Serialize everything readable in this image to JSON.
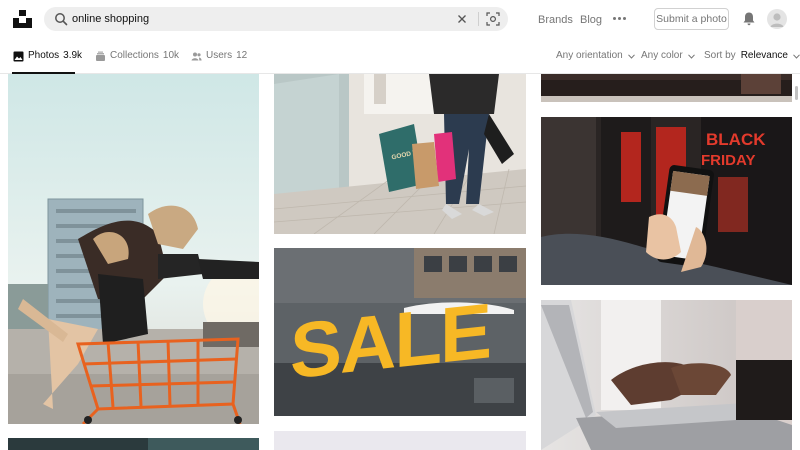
{
  "search": {
    "query": "online shopping"
  },
  "nav": {
    "brands": "Brands",
    "blog": "Blog",
    "submit": "Submit a photo"
  },
  "tabs": [
    {
      "label": "Photos",
      "count": "3.9k",
      "icon": "photo-icon"
    },
    {
      "label": "Collections",
      "count": "10k",
      "icon": "collections-icon"
    },
    {
      "label": "Users",
      "count": "12",
      "icon": "users-icon"
    }
  ],
  "filters": {
    "orientation": "Any orientation",
    "color": "Any color",
    "sort_prefix": "Sort by",
    "sort_value": "Relevance"
  },
  "photos": {
    "bag_text": "GOOD THINGS INSIDE",
    "sale_text": "SALE",
    "black_friday_1": "BLACK",
    "black_friday_2": "FRIDAY"
  },
  "colors": {
    "accent": "#111111",
    "muted": "#767676",
    "search_bg": "#eeeeee",
    "sale_yellow": "#f7b825"
  }
}
